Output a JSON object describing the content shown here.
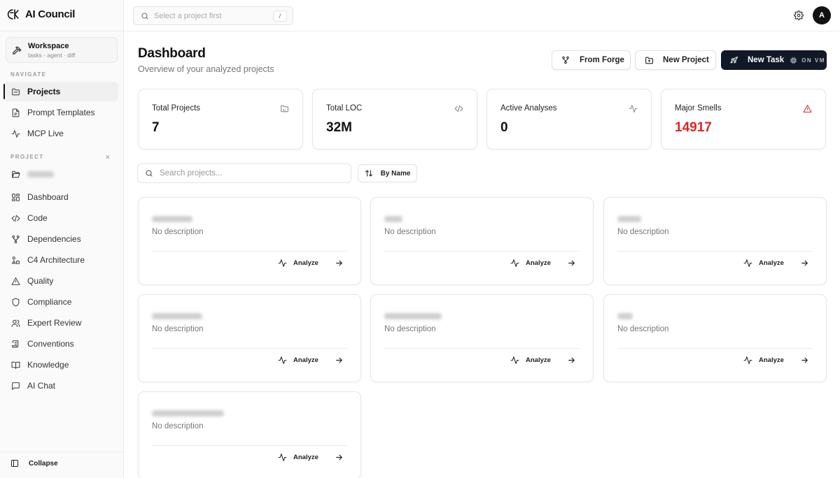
{
  "app": {
    "name": "AI Council"
  },
  "workspace": {
    "title": "Workspace",
    "subtitle": "tasks · agent · diff"
  },
  "sidebar": {
    "navigate_label": "NAVIGATE",
    "nav_items": [
      {
        "label": "Projects",
        "icon": "folder-icon",
        "active": true
      },
      {
        "label": "Prompt Templates",
        "icon": "file-text-icon"
      },
      {
        "label": "MCP Live",
        "icon": "activity-icon"
      }
    ],
    "project_label": "PROJECT",
    "project_items": [
      {
        "label": "Dashboard",
        "icon": "dashboard-icon"
      },
      {
        "label": "Code",
        "icon": "code-icon"
      },
      {
        "label": "Dependencies",
        "icon": "git-branch-icon"
      },
      {
        "label": "C4 Architecture",
        "icon": "shapes-icon"
      },
      {
        "label": "Quality",
        "icon": "triangle-alert-icon"
      },
      {
        "label": "Compliance",
        "icon": "shield-icon"
      },
      {
        "label": "Expert Review",
        "icon": "users-icon"
      },
      {
        "label": "Conventions",
        "icon": "scroll-icon"
      },
      {
        "label": "Knowledge",
        "icon": "book-icon"
      },
      {
        "label": "AI Chat",
        "icon": "message-icon"
      }
    ],
    "collapse_label": "Collapse"
  },
  "topbar": {
    "search_placeholder": "Select a project first",
    "shortcut": "/",
    "avatar_initial": "A"
  },
  "header": {
    "title": "Dashboard",
    "subtitle": "Overview of your analyzed projects",
    "from_forge_label": "From Forge",
    "new_project_label": "New Project",
    "new_task_label": "New Task",
    "on_vm_label": "ON VM"
  },
  "stats": [
    {
      "label": "Total Projects",
      "value": "7",
      "icon": "folder-icon"
    },
    {
      "label": "Total LOC",
      "value": "32M",
      "icon": "code-icon"
    },
    {
      "label": "Active Analyses",
      "value": "0",
      "icon": "activity-icon"
    },
    {
      "label": "Major Smells",
      "value": "14917",
      "icon": "triangle-alert-icon",
      "color": "#dc2626"
    }
  ],
  "filters": {
    "search_placeholder": "Search projects...",
    "sort_label": "By Name"
  },
  "projects": [
    {
      "description": "No description",
      "action": "Analyze"
    },
    {
      "description": "No description",
      "action": "Analyze"
    },
    {
      "description": "No description",
      "action": "Analyze"
    },
    {
      "description": "No description",
      "action": "Analyze"
    },
    {
      "description": "No description",
      "action": "Analyze"
    },
    {
      "description": "No description",
      "action": "Analyze"
    },
    {
      "description": "No description",
      "action": "Analyze"
    }
  ],
  "colors": {
    "accent_dark": "#111827",
    "danger": "#dc2626"
  }
}
